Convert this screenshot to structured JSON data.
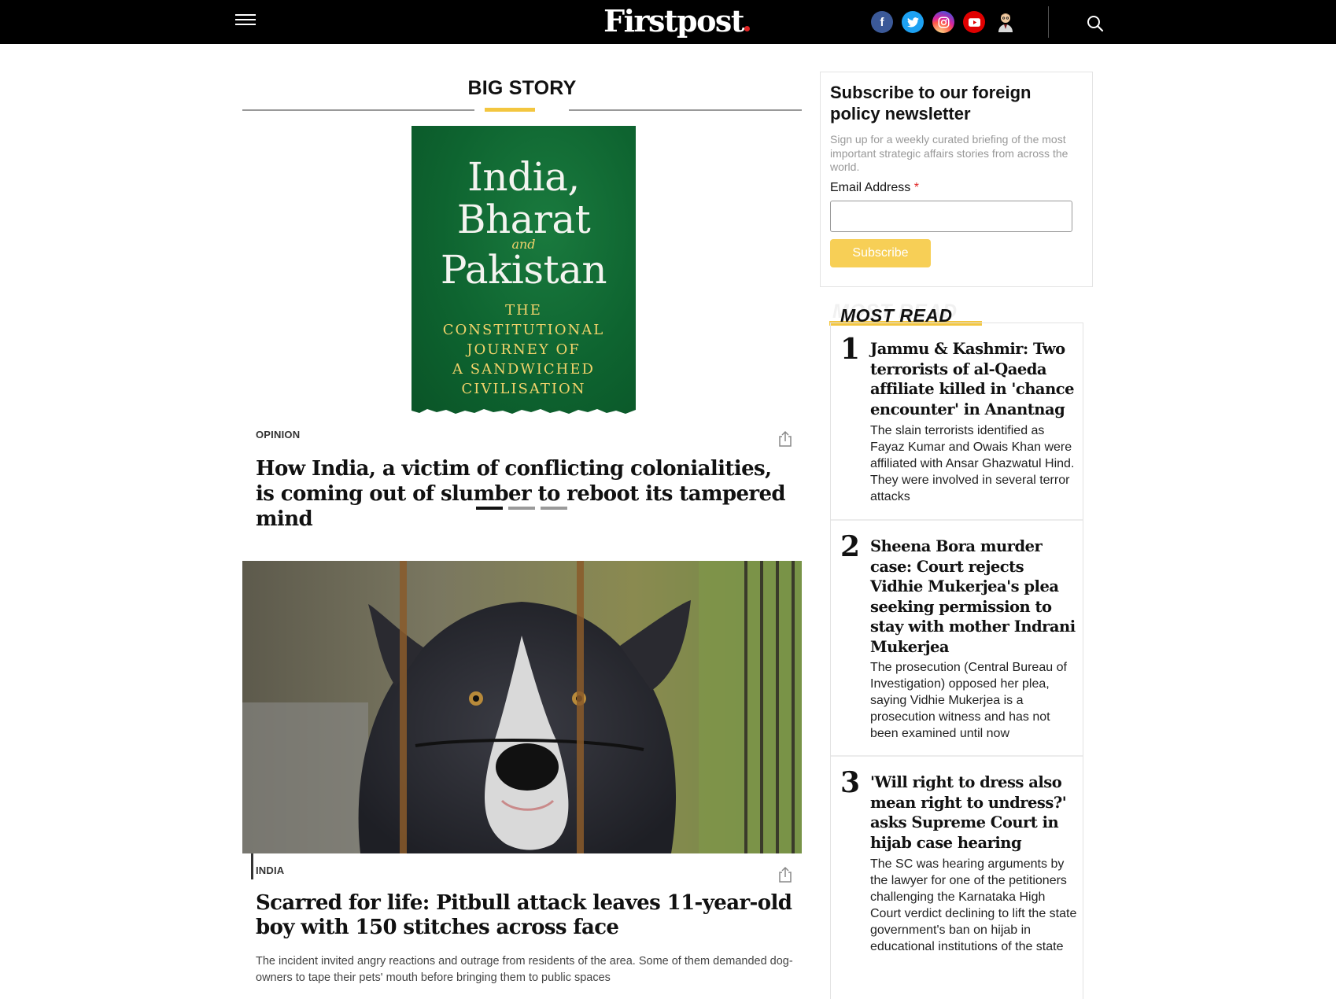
{
  "header": {
    "logo": "Firstpost",
    "social": [
      {
        "name": "facebook",
        "glyph": "f",
        "color": "#3b5998"
      },
      {
        "name": "twitter",
        "glyph": "t",
        "color": "#1da1f2"
      },
      {
        "name": "instagram",
        "glyph": "◎",
        "color": "#d6249f"
      },
      {
        "name": "youtube",
        "glyph": "▶",
        "color": "#e00000"
      },
      {
        "name": "profile",
        "glyph": "",
        "color": "#000000"
      }
    ]
  },
  "big_story": {
    "section_title": "BIG STORY",
    "book_cover": {
      "line1": "India,",
      "line2": "Bharat",
      "conj": "and",
      "line3": "Pakistan",
      "sub1": "THE",
      "sub2": "CONSTITUTIONAL",
      "sub3": "JOURNEY OF",
      "sub4": "A SANDWICHED",
      "sub5": "CIVILISATION"
    },
    "category": "OPINION",
    "headline": "How India, a victim of conflicting colonialities, is coming out of slumber to reboot its tampered mind",
    "carousel_active_index": 0,
    "carousel_count": 3
  },
  "story2": {
    "category": "INDIA",
    "headline": "Scarred for life: Pitbull attack leaves 11-year-old boy with 150 stitches across face",
    "description": "The incident invited angry reactions and outrage from residents of the area. Some of them demanded dog-owners to tape their pets' mouth before bringing them to public spaces"
  },
  "newsletter": {
    "title": "Subscribe to our foreign policy newsletter",
    "text": "Sign up for a weekly curated briefing of the most important strategic affairs stories from across the world.",
    "email_label": "Email Address",
    "required_mark": "*",
    "email_value": "",
    "button": "Subscribe"
  },
  "most_read": {
    "title": "MOST READ",
    "items": [
      {
        "rank": "1",
        "headline": "Jammu & Kashmir: Two terrorists of al-Qaeda affiliate killed in 'chance encounter' in Anantnag",
        "summary": "The slain terrorists identified as Fayaz Kumar and Owais Khan were affiliated with Ansar Ghazwatul Hind. They were involved in several terror attacks"
      },
      {
        "rank": "2",
        "headline": "Sheena Bora murder case: Court rejects Vidhie Mukerjea's plea seeking permission to stay with mother Indrani Mukerjea",
        "summary": "The prosecution (Central Bureau of Investigation) opposed her plea, saying Vidhie Mukerjea is a prosecution witness and has not been examined until now"
      },
      {
        "rank": "3",
        "headline": "'Will right to dress also mean right to undress?' asks Supreme Court in hijab case hearing",
        "summary": "The SC was hearing arguments by the lawyer for one of the petitioners challenging the Karnataka High Court verdict declining to lift the state government's ban on hijab in educational institutions of the state"
      }
    ]
  }
}
